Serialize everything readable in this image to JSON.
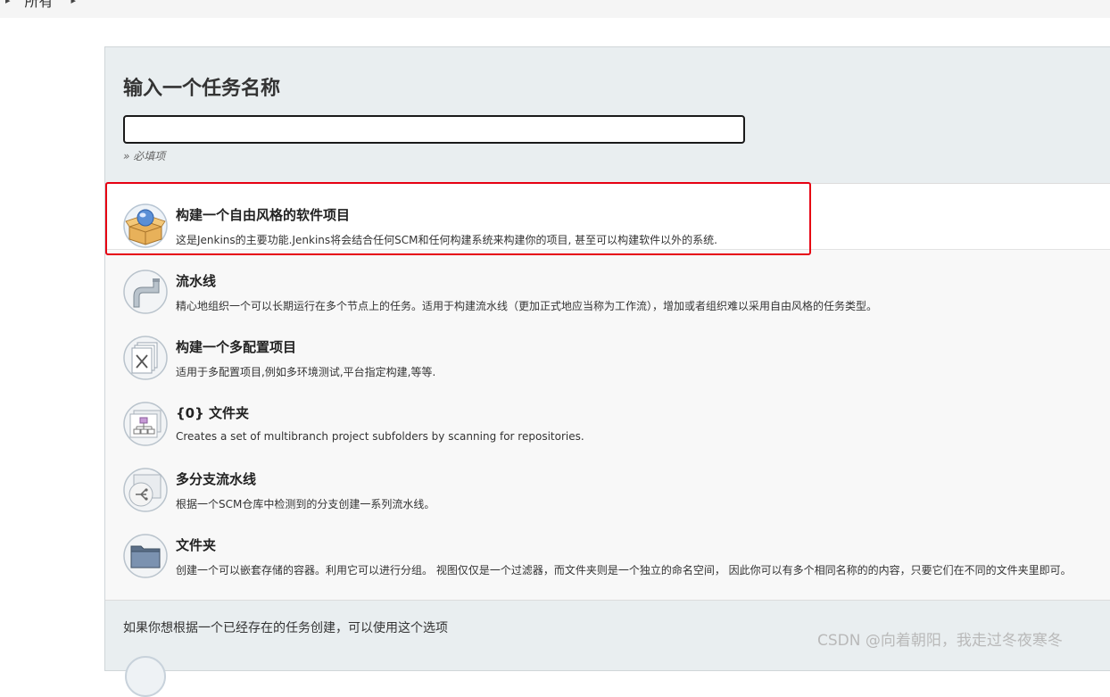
{
  "breadcrumb": {
    "items": [
      "所有"
    ],
    "separator_icon": "chevron-right-icon"
  },
  "new_item": {
    "heading": "输入一个任务名称",
    "name_value": "",
    "required_note": "» 必填项"
  },
  "item_types": [
    {
      "title": "构建一个自由风格的软件项目",
      "description": "这是Jenkins的主要功能.Jenkins将会结合任何SCM和任何构建系统来构建你的项目, 甚至可以构建软件以外的系统.",
      "icon": "freestyle-project-icon",
      "selected": true
    },
    {
      "title": "流水线",
      "description": "精心地组织一个可以长期运行在多个节点上的任务。适用于构建流水线（更加正式地应当称为工作流），增加或者组织难以采用自由风格的任务类型。",
      "icon": "pipeline-icon",
      "selected": false
    },
    {
      "title": "构建一个多配置项目",
      "description": "适用于多配置项目,例如多环境测试,平台指定构建,等等.",
      "icon": "multi-config-project-icon",
      "selected": false
    },
    {
      "title": "{0} 文件夹",
      "description": "Creates a set of multibranch project subfolders by scanning for repositories.",
      "icon": "org-folder-icon",
      "selected": false
    },
    {
      "title": "多分支流水线",
      "description": "根据一个SCM仓库中检测到的分支创建一系列流水线。",
      "icon": "multibranch-pipeline-icon",
      "selected": false
    },
    {
      "title": "文件夹",
      "description": "创建一个可以嵌套存储的容器。利用它可以进行分组。 视图仅仅是一个过滤器，而文件夹则是一个独立的命名空间， 因此你可以有多个相同名称的的内容，只要它们在不同的文件夹里即可。",
      "icon": "folder-icon",
      "selected": false
    }
  ],
  "copy_from": {
    "text": "如果你想根据一个已经存在的任务创建，可以使用这个选项"
  },
  "watermark": "CSDN @向着朝阳，我走过冬夜寒冬",
  "colors": {
    "highlight_border": "#e60012",
    "panel_bg": "#e9eef0",
    "list_bg": "#f8f8f8"
  }
}
